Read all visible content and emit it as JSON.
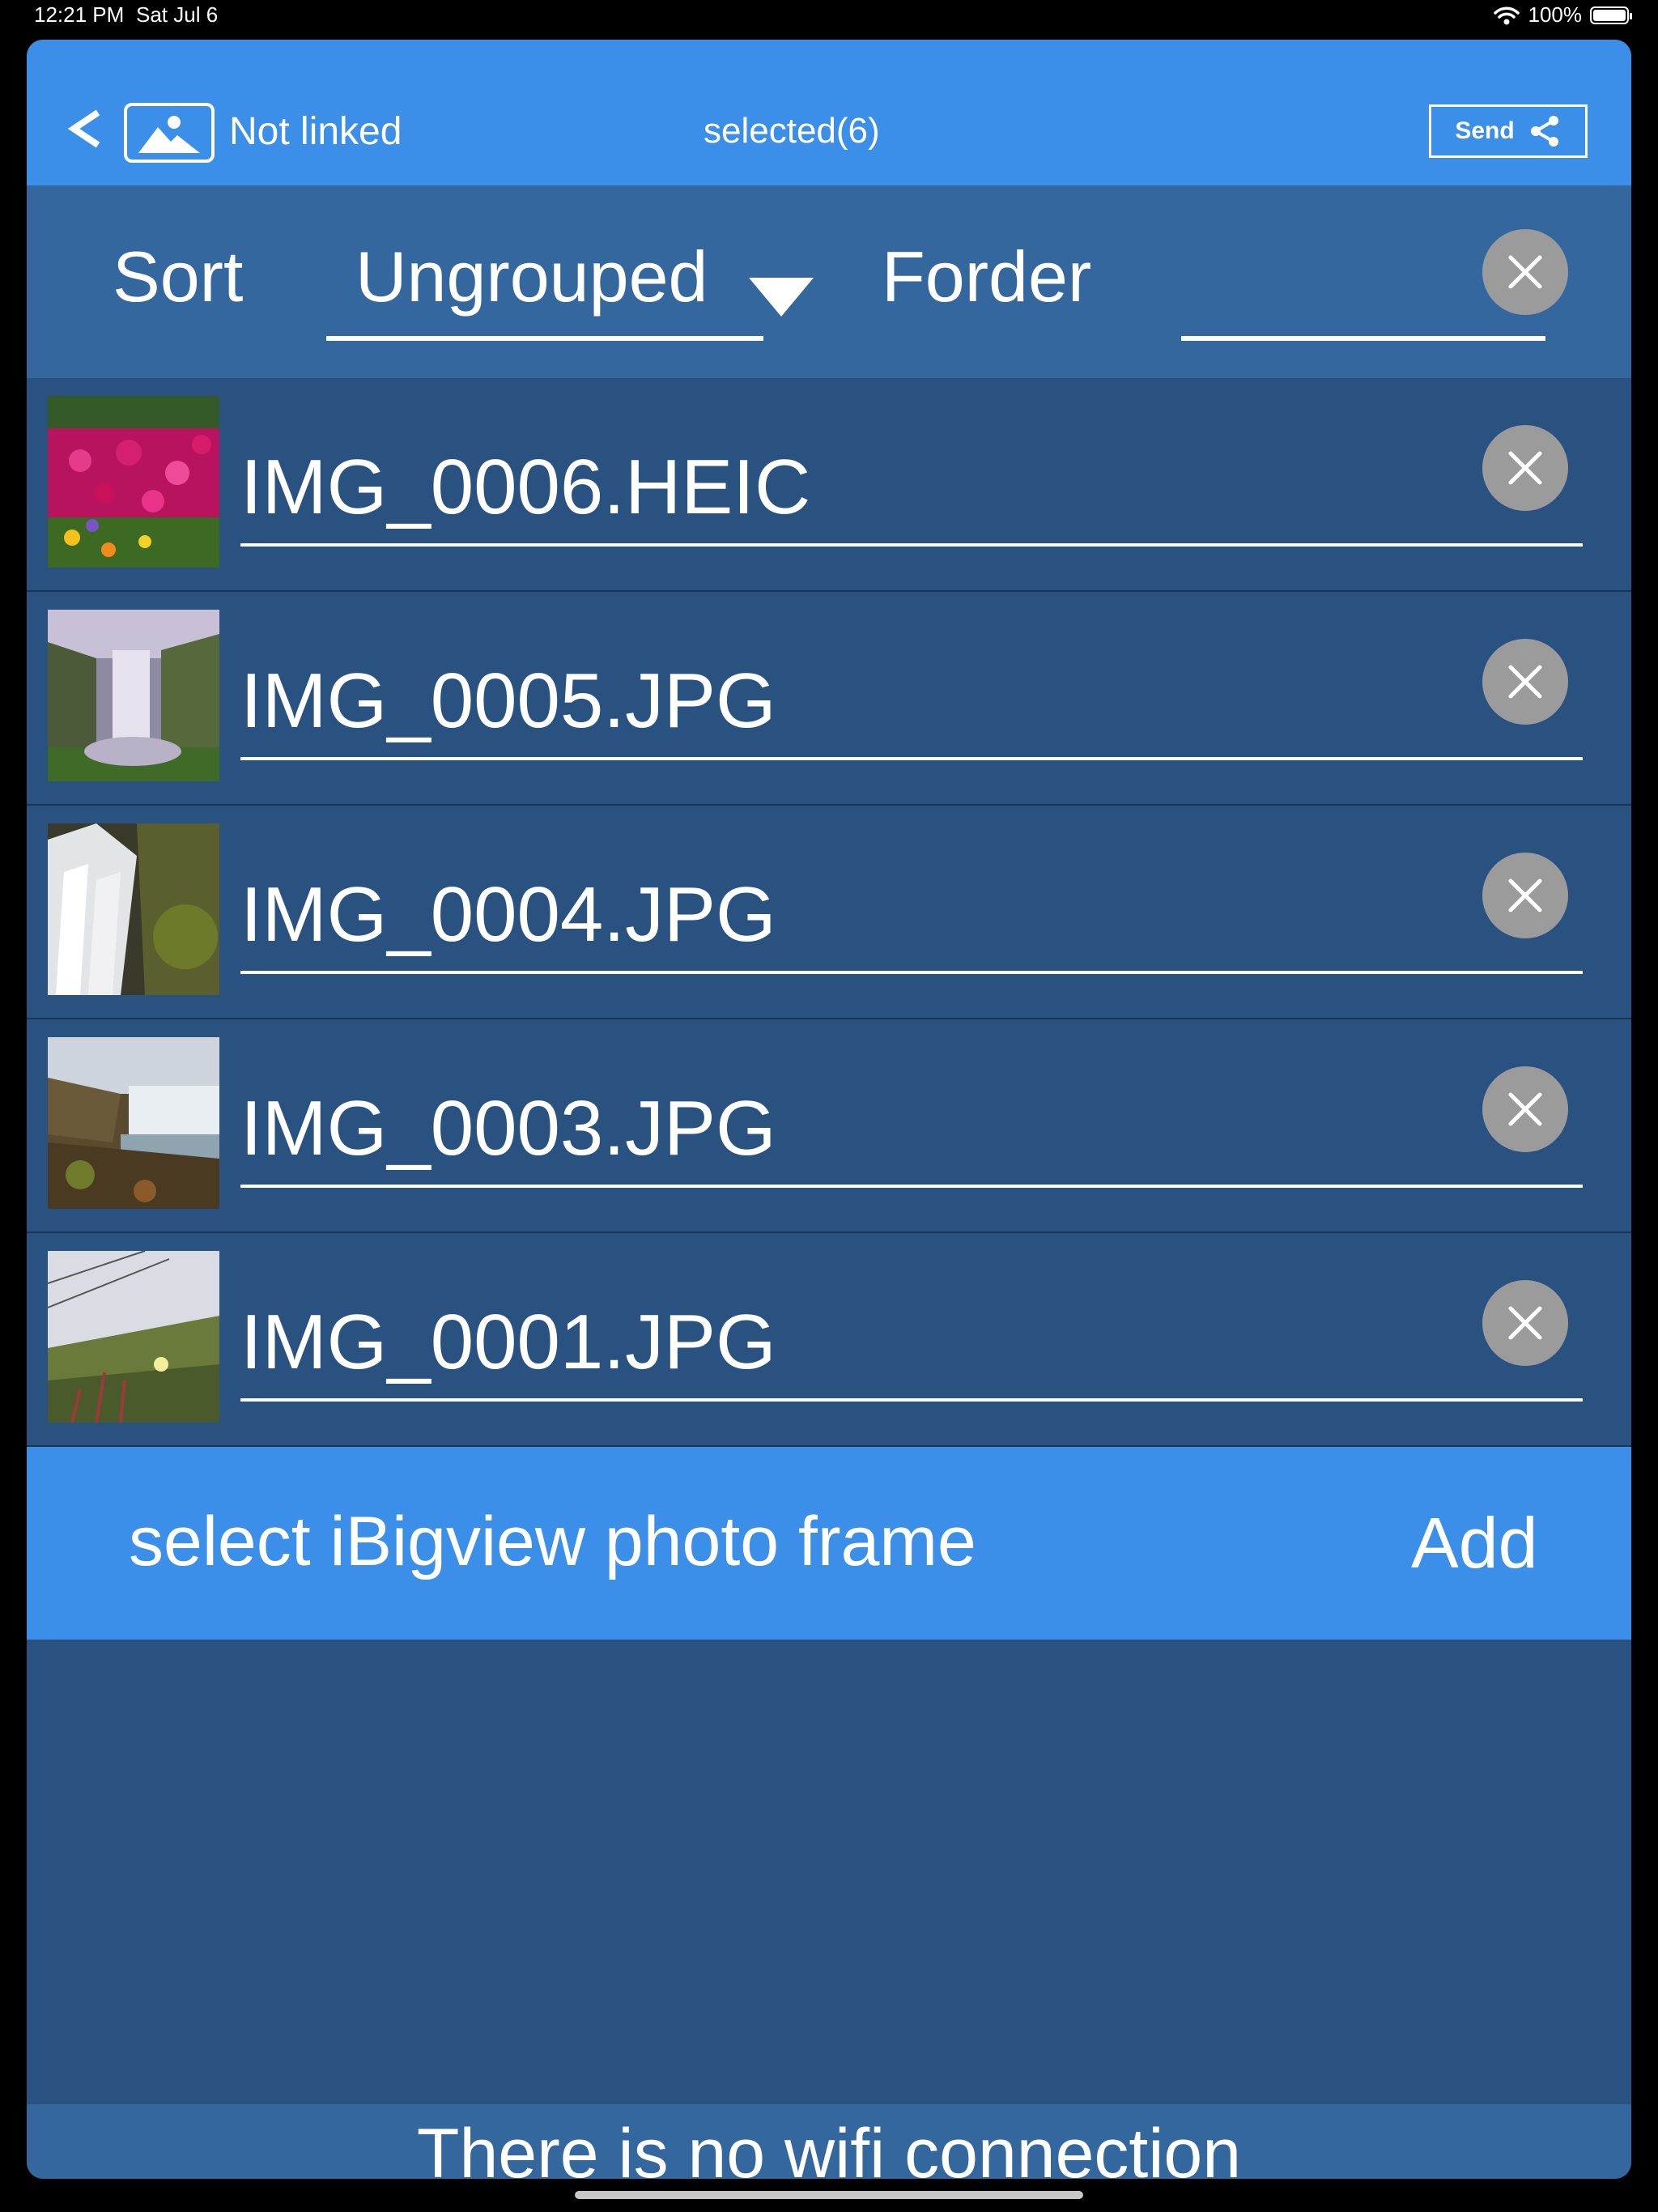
{
  "status_bar": {
    "time": "12:21 PM",
    "date": "Sat Jul 6",
    "battery": "100%",
    "battery_level": 1.0
  },
  "nav": {
    "back_icon": "chevron-left-icon",
    "photo_icon": "photo-frame-icon",
    "link_status": "Not linked",
    "title": "selected(6)",
    "send_label": "Send",
    "share_icon": "share-icon"
  },
  "sort_bar": {
    "sort_label": "Sort",
    "group_value": "Ungrouped",
    "folder_label": "Forder",
    "folder_value": ""
  },
  "files": [
    {
      "name": "IMG_0006.HEIC"
    },
    {
      "name": "IMG_0005.JPG"
    },
    {
      "name": "IMG_0004.JPG"
    },
    {
      "name": "IMG_0003.JPG"
    },
    {
      "name": "IMG_0001.JPG"
    }
  ],
  "frame_bar": {
    "label": "select iBigview photo frame",
    "add_label": "Add"
  },
  "wifi_status": "There is no wifi connection",
  "colors": {
    "nav_blue": "#3b8fe9",
    "panel_dark": "#2a5280",
    "sort_blue": "#33679e",
    "clear_gray": "#9b9b9b"
  }
}
